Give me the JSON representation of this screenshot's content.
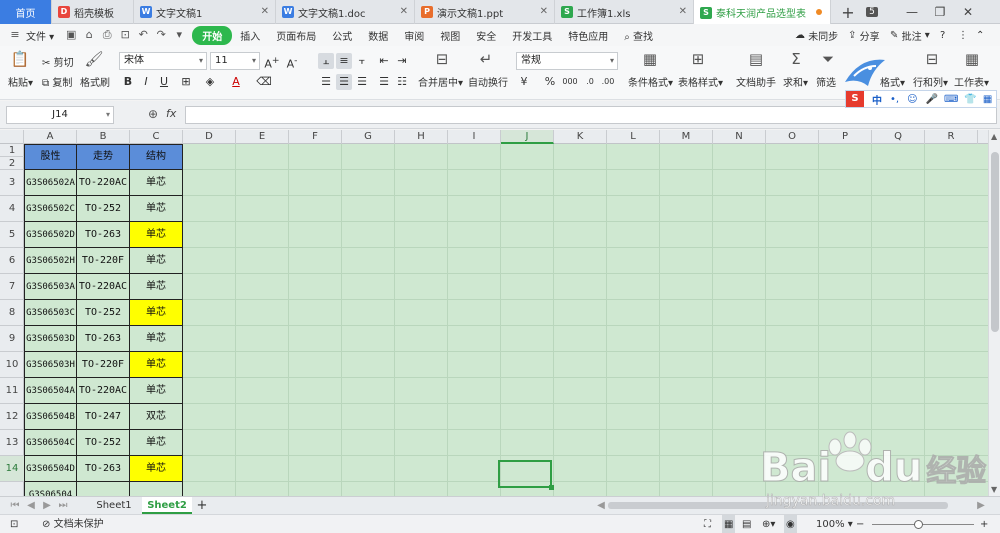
{
  "tabs": [
    {
      "label": "首页",
      "type": "home"
    },
    {
      "label": "稻壳模板",
      "icon": "D",
      "color": "#e8453c"
    },
    {
      "label": "文字文稿1",
      "icon": "W",
      "color": "#3b7de2"
    },
    {
      "label": "文字文稿1.doc",
      "icon": "W",
      "color": "#3b7de2"
    },
    {
      "label": "演示文稿1.ppt",
      "icon": "P",
      "color": "#e86d2c"
    },
    {
      "label": "工作簿1.xls",
      "icon": "S",
      "color": "#2fa84f"
    },
    {
      "label": "泰科天润产品选型表",
      "icon": "S",
      "color": "#2fa84f"
    }
  ],
  "tab_counter": "5",
  "menu": {
    "file": "文件",
    "items": [
      "开始",
      "插入",
      "页面布局",
      "公式",
      "数据",
      "审阅",
      "视图",
      "安全",
      "开发工具",
      "特色应用"
    ],
    "search": "查找",
    "sync": "未同步",
    "share": "分享",
    "comment": "批注"
  },
  "ribbon": {
    "paste": "粘贴",
    "cut": "剪切",
    "copy": "复制",
    "format_painter": "格式刷",
    "font": "宋体",
    "font_size": "11",
    "merge": "合并居中",
    "wrap": "自动换行",
    "number_format": "常规",
    "cond_format": "条件格式",
    "table_style": "表格样式",
    "doc_assist": "文档助手",
    "sum": "求和",
    "filter": "筛选",
    "format": "格式",
    "row_col": "行和列",
    "worksheet": "工作表"
  },
  "formula_bar": {
    "cell_ref": "J14",
    "fx": "fx",
    "content": ""
  },
  "ime": {
    "lang": "中"
  },
  "columns": [
    "A",
    "B",
    "C",
    "D",
    "E",
    "F",
    "G",
    "H",
    "I",
    "J",
    "K",
    "L",
    "M",
    "N",
    "O",
    "P",
    "Q",
    "R"
  ],
  "selected_column": "J",
  "selected_row": "14",
  "header_row": [
    "股性",
    "走势",
    "结构"
  ],
  "rows": [
    {
      "num": "3",
      "a": "G3S06502A",
      "b": "TO-220AC",
      "c": "单芯",
      "hl": false
    },
    {
      "num": "4",
      "a": "G3S06502C",
      "b": "TO-252",
      "c": "单芯",
      "hl": false
    },
    {
      "num": "5",
      "a": "G3S06502D",
      "b": "TO-263",
      "c": "单芯",
      "hl": true
    },
    {
      "num": "6",
      "a": "G3S06502H",
      "b": "TO-220F",
      "c": "单芯",
      "hl": false
    },
    {
      "num": "7",
      "a": "G3S06503A",
      "b": "TO-220AC",
      "c": "单芯",
      "hl": false
    },
    {
      "num": "8",
      "a": "G3S06503C",
      "b": "TO-252",
      "c": "单芯",
      "hl": true
    },
    {
      "num": "9",
      "a": "G3S06503D",
      "b": "TO-263",
      "c": "单芯",
      "hl": false
    },
    {
      "num": "10",
      "a": "G3S06503H",
      "b": "TO-220F",
      "c": "单芯",
      "hl": true
    },
    {
      "num": "11",
      "a": "G3S06504A",
      "b": "TO-220AC",
      "c": "单芯",
      "hl": false
    },
    {
      "num": "12",
      "a": "G3S06504B",
      "b": "TO-247",
      "c": "双芯",
      "hl": false
    },
    {
      "num": "13",
      "a": "G3S06504C",
      "b": "TO-252",
      "c": "单芯",
      "hl": false
    },
    {
      "num": "14",
      "a": "G3S06504D",
      "b": "TO-263",
      "c": "单芯",
      "hl": true
    },
    {
      "num": "",
      "a": "G3S06504",
      "b": "",
      "c": "",
      "hl": false
    }
  ],
  "sheets": [
    "Sheet1",
    "Sheet2"
  ],
  "active_sheet": "Sheet2",
  "status": {
    "protect": "文档未保护",
    "zoom": "100%"
  },
  "watermark": {
    "brand": "Bai",
    "brand2": "du",
    "cn": "经验",
    "url": "jingyan.baidu.com"
  },
  "colors": {
    "accent": "#2f9e44",
    "header_fill": "#5b8dd9",
    "highlight": "#ffff00",
    "eye_protect": "#cfe8d1"
  }
}
